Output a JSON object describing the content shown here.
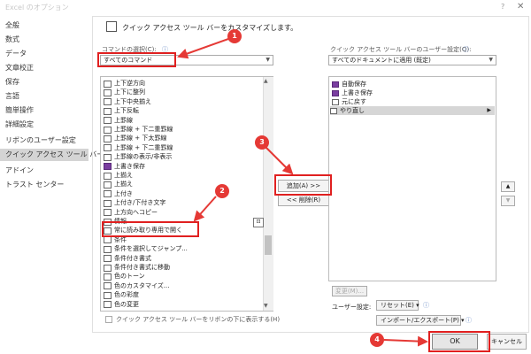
{
  "window": {
    "title": "Excel のオプション",
    "help": "?",
    "close": "✕"
  },
  "sidebar": {
    "items": [
      {
        "label": "全般"
      },
      {
        "label": "数式"
      },
      {
        "label": "データ"
      },
      {
        "label": "文章校正"
      },
      {
        "label": "保存"
      },
      {
        "label": "言語"
      },
      {
        "label": "簡単操作"
      },
      {
        "label": "詳細設定"
      },
      {
        "label": "リボンのユーザー設定"
      },
      {
        "label": "クイック アクセス ツール バー",
        "selected": true
      },
      {
        "label": "アドイン"
      },
      {
        "label": "トラスト センター"
      }
    ]
  },
  "main": {
    "header": "クイック アクセス ツール バーをカスタマイズします。",
    "command_label": "コマンドの選択(C):",
    "command_dropdown": "すべてのコマンド",
    "qat_label": "クイック アクセス ツール バーのユーザー設定(Q):",
    "qat_dropdown": "すべてのドキュメントに適用 (既定)",
    "info_icon": "ⓘ",
    "commands": [
      {
        "label": "上下逆方向",
        "icon": "plain"
      },
      {
        "label": "上下に整列",
        "icon": "plain"
      },
      {
        "label": "上下中央揃え",
        "icon": "plain"
      },
      {
        "label": "上下反転",
        "icon": "plain"
      },
      {
        "label": "上罫線",
        "icon": "plain"
      },
      {
        "label": "上罫線 + 下二重罫線",
        "icon": "plain"
      },
      {
        "label": "上罫線 + 下太罫線",
        "icon": "plain"
      },
      {
        "label": "上罫線 + 下二重罫線",
        "icon": "plain"
      },
      {
        "label": "上罫線の表示/非表示",
        "icon": "plain"
      },
      {
        "label": "上書き保存",
        "icon": "purple"
      },
      {
        "label": "上揃え",
        "icon": "plain"
      },
      {
        "label": "上揃え",
        "icon": "plain"
      },
      {
        "label": "上付き",
        "icon": "plain"
      },
      {
        "label": "上付き/下付き文字",
        "icon": "plain",
        "submenu": "▸"
      },
      {
        "label": "上方向へコピー",
        "icon": "plain"
      },
      {
        "label": "情報",
        "icon": "plain"
      },
      {
        "label": "常に読み取り専用で開く",
        "icon": "plain"
      },
      {
        "label": "条件",
        "icon": "plain",
        "submenu": "▸"
      },
      {
        "label": "条件を選択してジャンプ...",
        "icon": "plain"
      },
      {
        "label": "条件付き書式",
        "icon": "plain",
        "submenu": "▸"
      },
      {
        "label": "条件付き書式に移動",
        "icon": "plain"
      },
      {
        "label": "色のトーン",
        "icon": "plain",
        "submenu": "▸"
      },
      {
        "label": "色のカスタマイズ...",
        "icon": "plain"
      },
      {
        "label": "色の彩度",
        "icon": "plain",
        "submenu": "▸"
      },
      {
        "label": "色の変更",
        "icon": "plain",
        "submenu": "▸"
      }
    ],
    "qat_items": [
      {
        "label": "自動保存",
        "icon": "purple"
      },
      {
        "label": "上書き保存",
        "icon": "purple"
      },
      {
        "label": "元に戻す",
        "icon": "plain"
      },
      {
        "label": "やり直し",
        "icon": "plain",
        "selected": true
      }
    ],
    "show_below_label": "クイック アクセス ツール バーをリボンの下に表示する(H)",
    "add_button": "追加(A) >>",
    "remove_button": "<< 削除(R)",
    "up_button": "▲",
    "down_button": "▼",
    "modify_button": "変更(M)...",
    "user_settings_label": "ユーザー設定:",
    "reset_button": "リセット(E) ▾",
    "import_button": "インポート/エクスポート(P) ▾",
    "box_icon_text": "⊡"
  },
  "footer": {
    "ok": "OK",
    "cancel": "キャンセル"
  },
  "annotations": {
    "badges": [
      "1",
      "2",
      "3",
      "4"
    ],
    "color": "#e53935"
  }
}
